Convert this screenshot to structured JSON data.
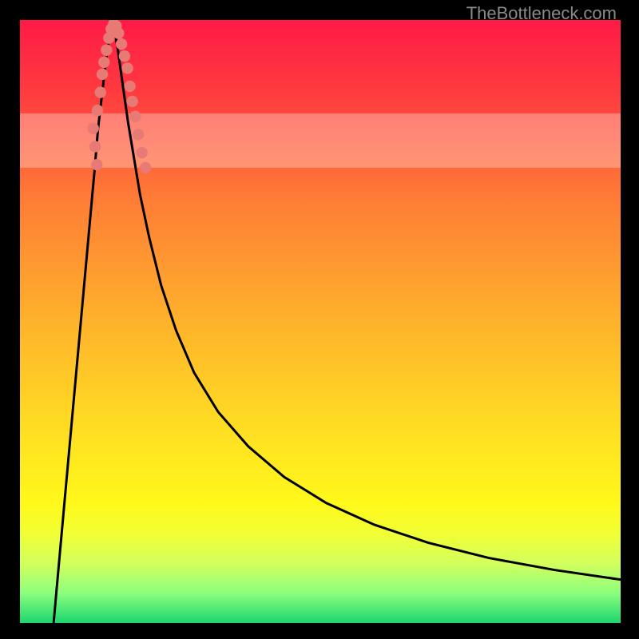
{
  "watermark": "TheBottleneck.com",
  "chart_data": {
    "type": "line",
    "title": "",
    "xlabel": "",
    "ylabel": "",
    "xlim": [
      0,
      100
    ],
    "ylim": [
      0,
      100
    ],
    "background_gradient": {
      "stops": [
        {
          "pos": 0.0,
          "color": "#ff1a47"
        },
        {
          "pos": 0.12,
          "color": "#ff3b3f"
        },
        {
          "pos": 0.3,
          "color": "#ff7d36"
        },
        {
          "pos": 0.5,
          "color": "#ffb22b"
        },
        {
          "pos": 0.7,
          "color": "#ffe321"
        },
        {
          "pos": 0.8,
          "color": "#fff81a"
        },
        {
          "pos": 0.85,
          "color": "#f2ff33"
        },
        {
          "pos": 0.9,
          "color": "#d4ff5c"
        },
        {
          "pos": 0.95,
          "color": "#8dff7d"
        },
        {
          "pos": 1.0,
          "color": "#1bd66f"
        }
      ]
    },
    "pale_band": {
      "y1": 75.5,
      "y2": 84.5,
      "opacity": 0.3
    },
    "series": [
      {
        "name": "left-branch",
        "x": [
          5.6,
          6.5,
          7.5,
          8.5,
          9.5,
          10.5,
          11.5,
          12.5,
          13.0,
          13.7,
          14.3,
          14.8,
          15.5
        ],
        "y": [
          0,
          10,
          21,
          32,
          43,
          54,
          65,
          76,
          82,
          88,
          93,
          96.5,
          100
        ]
      },
      {
        "name": "right-branch",
        "x": [
          15.5,
          16.3,
          17.0,
          18.0,
          19.0,
          20.0,
          21.5,
          23.5,
          26.0,
          29.0,
          33.0,
          38.0,
          44.0,
          51.0,
          59.0,
          68.0,
          78.0,
          89.0,
          100.0
        ],
        "y": [
          100,
          95,
          90,
          83,
          77,
          71,
          64,
          56,
          48.5,
          41.5,
          35,
          29.3,
          24.2,
          19.9,
          16.3,
          13.3,
          10.8,
          8.8,
          7.2
        ]
      }
    ],
    "scatter_points": [
      {
        "x": 12.8,
        "y": 76
      },
      {
        "x": 12.5,
        "y": 79
      },
      {
        "x": 12.2,
        "y": 82
      },
      {
        "x": 12.9,
        "y": 85
      },
      {
        "x": 13.4,
        "y": 88
      },
      {
        "x": 13.7,
        "y": 91
      },
      {
        "x": 14.0,
        "y": 93
      },
      {
        "x": 14.4,
        "y": 95
      },
      {
        "x": 14.8,
        "y": 97
      },
      {
        "x": 15.2,
        "y": 98.5
      },
      {
        "x": 15.6,
        "y": 99.3
      },
      {
        "x": 16.0,
        "y": 99.0
      },
      {
        "x": 16.4,
        "y": 97.8
      },
      {
        "x": 16.9,
        "y": 96
      },
      {
        "x": 17.4,
        "y": 94
      },
      {
        "x": 17.9,
        "y": 92
      },
      {
        "x": 18.3,
        "y": 89
      },
      {
        "x": 18.7,
        "y": 86.5
      },
      {
        "x": 19.2,
        "y": 84
      },
      {
        "x": 19.7,
        "y": 81
      },
      {
        "x": 20.3,
        "y": 78
      },
      {
        "x": 20.9,
        "y": 75.5
      }
    ],
    "scatter_color": "#e77a74",
    "curve_color": "#000000"
  }
}
